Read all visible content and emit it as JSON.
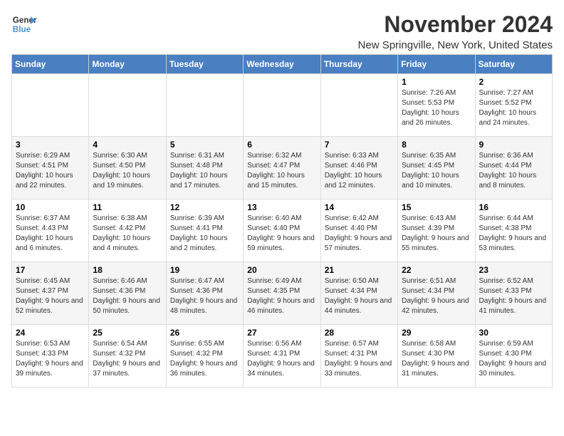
{
  "logo": {
    "line1": "General",
    "line2": "Blue"
  },
  "title": "November 2024",
  "location": "New Springville, New York, United States",
  "days_of_week": [
    "Sunday",
    "Monday",
    "Tuesday",
    "Wednesday",
    "Thursday",
    "Friday",
    "Saturday"
  ],
  "weeks": [
    [
      {
        "day": "",
        "detail": ""
      },
      {
        "day": "",
        "detail": ""
      },
      {
        "day": "",
        "detail": ""
      },
      {
        "day": "",
        "detail": ""
      },
      {
        "day": "",
        "detail": ""
      },
      {
        "day": "1",
        "detail": "Sunrise: 7:26 AM\nSunset: 5:53 PM\nDaylight: 10 hours and 26 minutes."
      },
      {
        "day": "2",
        "detail": "Sunrise: 7:27 AM\nSunset: 5:52 PM\nDaylight: 10 hours and 24 minutes."
      }
    ],
    [
      {
        "day": "3",
        "detail": "Sunrise: 6:29 AM\nSunset: 4:51 PM\nDaylight: 10 hours and 22 minutes."
      },
      {
        "day": "4",
        "detail": "Sunrise: 6:30 AM\nSunset: 4:50 PM\nDaylight: 10 hours and 19 minutes."
      },
      {
        "day": "5",
        "detail": "Sunrise: 6:31 AM\nSunset: 4:48 PM\nDaylight: 10 hours and 17 minutes."
      },
      {
        "day": "6",
        "detail": "Sunrise: 6:32 AM\nSunset: 4:47 PM\nDaylight: 10 hours and 15 minutes."
      },
      {
        "day": "7",
        "detail": "Sunrise: 6:33 AM\nSunset: 4:46 PM\nDaylight: 10 hours and 12 minutes."
      },
      {
        "day": "8",
        "detail": "Sunrise: 6:35 AM\nSunset: 4:45 PM\nDaylight: 10 hours and 10 minutes."
      },
      {
        "day": "9",
        "detail": "Sunrise: 6:36 AM\nSunset: 4:44 PM\nDaylight: 10 hours and 8 minutes."
      }
    ],
    [
      {
        "day": "10",
        "detail": "Sunrise: 6:37 AM\nSunset: 4:43 PM\nDaylight: 10 hours and 6 minutes."
      },
      {
        "day": "11",
        "detail": "Sunrise: 6:38 AM\nSunset: 4:42 PM\nDaylight: 10 hours and 4 minutes."
      },
      {
        "day": "12",
        "detail": "Sunrise: 6:39 AM\nSunset: 4:41 PM\nDaylight: 10 hours and 2 minutes."
      },
      {
        "day": "13",
        "detail": "Sunrise: 6:40 AM\nSunset: 4:40 PM\nDaylight: 9 hours and 59 minutes."
      },
      {
        "day": "14",
        "detail": "Sunrise: 6:42 AM\nSunset: 4:40 PM\nDaylight: 9 hours and 57 minutes."
      },
      {
        "day": "15",
        "detail": "Sunrise: 6:43 AM\nSunset: 4:39 PM\nDaylight: 9 hours and 55 minutes."
      },
      {
        "day": "16",
        "detail": "Sunrise: 6:44 AM\nSunset: 4:38 PM\nDaylight: 9 hours and 53 minutes."
      }
    ],
    [
      {
        "day": "17",
        "detail": "Sunrise: 6:45 AM\nSunset: 4:37 PM\nDaylight: 9 hours and 52 minutes."
      },
      {
        "day": "18",
        "detail": "Sunrise: 6:46 AM\nSunset: 4:36 PM\nDaylight: 9 hours and 50 minutes."
      },
      {
        "day": "19",
        "detail": "Sunrise: 6:47 AM\nSunset: 4:36 PM\nDaylight: 9 hours and 48 minutes."
      },
      {
        "day": "20",
        "detail": "Sunrise: 6:49 AM\nSunset: 4:35 PM\nDaylight: 9 hours and 46 minutes."
      },
      {
        "day": "21",
        "detail": "Sunrise: 6:50 AM\nSunset: 4:34 PM\nDaylight: 9 hours and 44 minutes."
      },
      {
        "day": "22",
        "detail": "Sunrise: 6:51 AM\nSunset: 4:34 PM\nDaylight: 9 hours and 42 minutes."
      },
      {
        "day": "23",
        "detail": "Sunrise: 6:52 AM\nSunset: 4:33 PM\nDaylight: 9 hours and 41 minutes."
      }
    ],
    [
      {
        "day": "24",
        "detail": "Sunrise: 6:53 AM\nSunset: 4:33 PM\nDaylight: 9 hours and 39 minutes."
      },
      {
        "day": "25",
        "detail": "Sunrise: 6:54 AM\nSunset: 4:32 PM\nDaylight: 9 hours and 37 minutes."
      },
      {
        "day": "26",
        "detail": "Sunrise: 6:55 AM\nSunset: 4:32 PM\nDaylight: 9 hours and 36 minutes."
      },
      {
        "day": "27",
        "detail": "Sunrise: 6:56 AM\nSunset: 4:31 PM\nDaylight: 9 hours and 34 minutes."
      },
      {
        "day": "28",
        "detail": "Sunrise: 6:57 AM\nSunset: 4:31 PM\nDaylight: 9 hours and 33 minutes."
      },
      {
        "day": "29",
        "detail": "Sunrise: 6:58 AM\nSunset: 4:30 PM\nDaylight: 9 hours and 31 minutes."
      },
      {
        "day": "30",
        "detail": "Sunrise: 6:59 AM\nSunset: 4:30 PM\nDaylight: 9 hours and 30 minutes."
      }
    ]
  ]
}
